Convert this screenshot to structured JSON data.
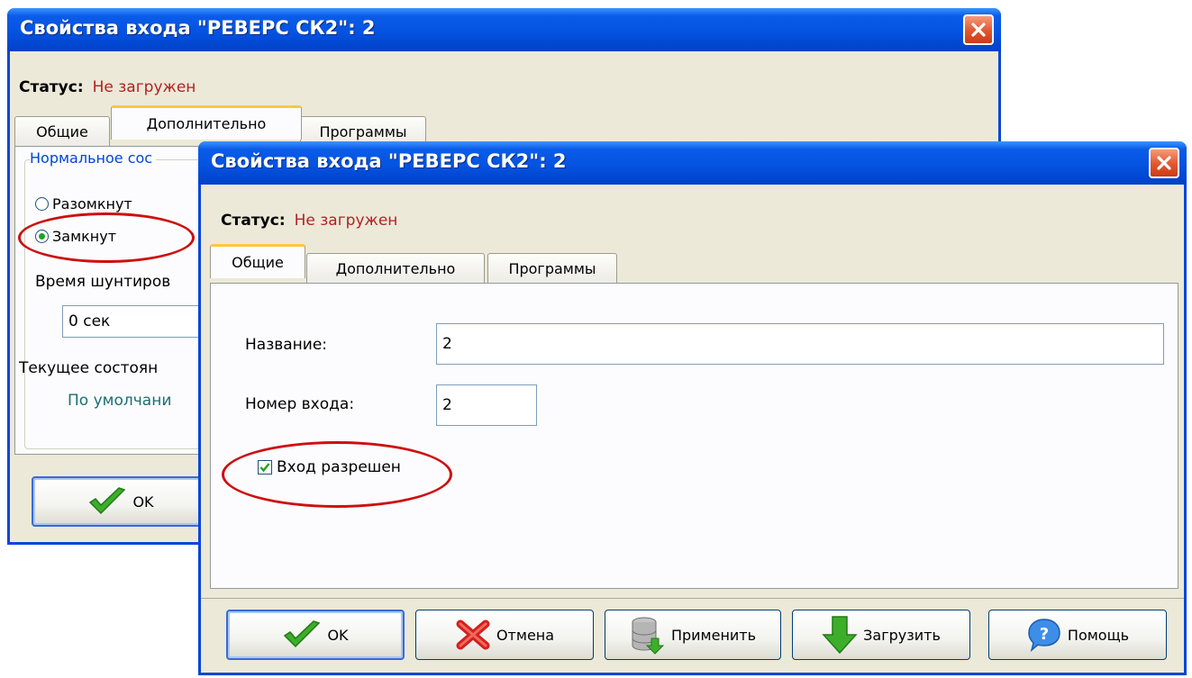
{
  "back_dialog": {
    "title": "Свойства входа \"РЕВЕРС СК2\": 2",
    "status_label": "Статус:",
    "status_value": "Не загружен",
    "tabs": [
      "Общие",
      "Дополнительно",
      "Программы"
    ],
    "active_tab": "Дополнительно",
    "group_legend": "Нормальное сос",
    "radio_open": "Разомкнут",
    "radio_closed": "Замкнут",
    "shunt_label": "Время шунтиров",
    "shunt_value": "0 сек",
    "current_state_label": "Текущее состоян",
    "current_state_value": "По умолчани",
    "ok_label": "OK"
  },
  "front_dialog": {
    "title": "Свойства входа \"РЕВЕРС СК2\": 2",
    "status_label": "Статус:",
    "status_value": "Не загружен",
    "tabs": [
      "Общие",
      "Дополнительно",
      "Программы"
    ],
    "active_tab": "Общие",
    "name_label": "Название:",
    "name_value": "2",
    "input_number_label": "Номер входа:",
    "input_number_value": "2",
    "enabled_label": "Вход разрешен",
    "buttons": {
      "ok": "OK",
      "cancel": "Отмена",
      "apply": "Применить",
      "load": "Загрузить",
      "help": "Помощь"
    }
  },
  "colors": {
    "titlebar": "#0553e1",
    "status_value": "#b22222",
    "highlight": "#cc1010",
    "accent": "#0046d5"
  }
}
